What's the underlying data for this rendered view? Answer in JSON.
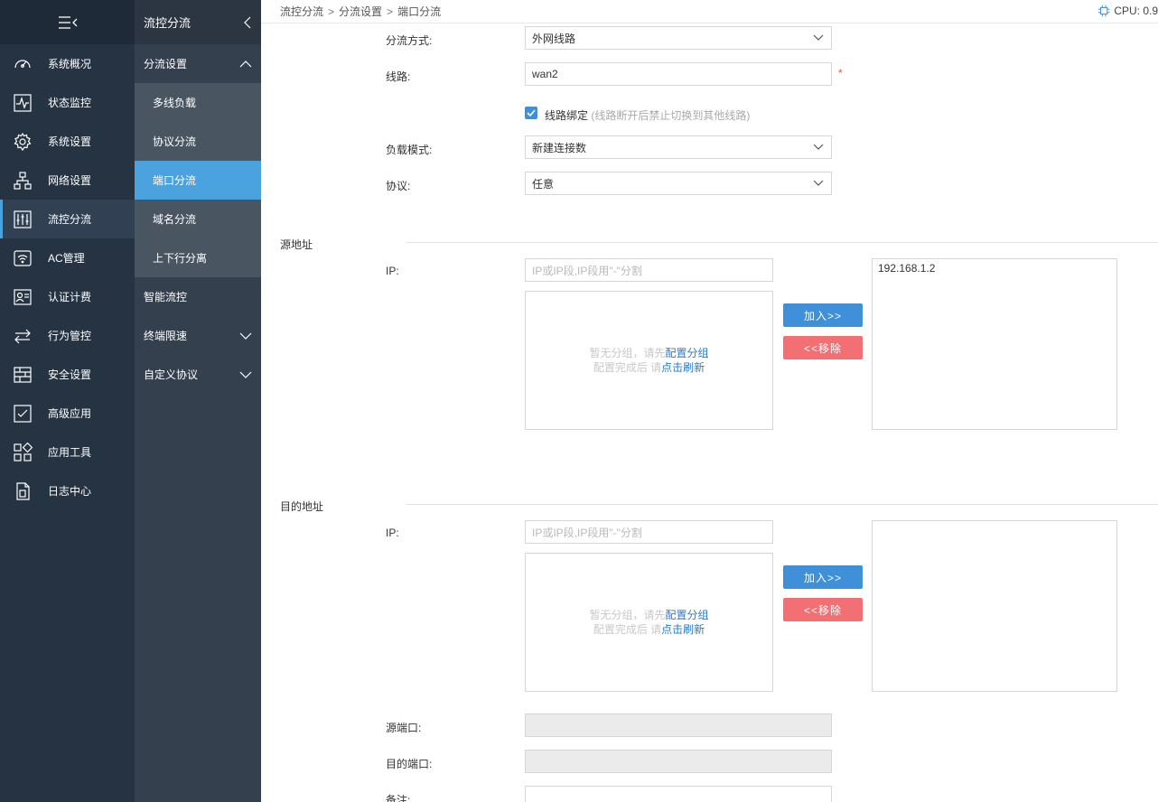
{
  "sidebar": {
    "toggle_icon": "menu-collapse-icon",
    "items": [
      {
        "label": "系统概况",
        "icon": "dashboard-icon"
      },
      {
        "label": "状态监控",
        "icon": "monitor-icon"
      },
      {
        "label": "系统设置",
        "icon": "gear-icon"
      },
      {
        "label": "网络设置",
        "icon": "network-icon"
      },
      {
        "label": "流控分流",
        "icon": "sliders-icon"
      },
      {
        "label": "AC管理",
        "icon": "wifi-icon"
      },
      {
        "label": "认证计费",
        "icon": "id-card-icon"
      },
      {
        "label": "行为管控",
        "icon": "arrows-exchange-icon"
      },
      {
        "label": "安全设置",
        "icon": "firewall-icon"
      },
      {
        "label": "高级应用",
        "icon": "checklist-icon"
      },
      {
        "label": "应用工具",
        "icon": "apps-icon"
      },
      {
        "label": "日志中心",
        "icon": "document-icon"
      }
    ]
  },
  "submenu": {
    "title": "流控分流",
    "groups": [
      {
        "label": "分流设置"
      },
      {
        "label": "智能流控"
      },
      {
        "label": "终端限速"
      },
      {
        "label": "自定义协议"
      }
    ],
    "children": [
      {
        "label": "多线负载"
      },
      {
        "label": "协议分流"
      },
      {
        "label": "端口分流"
      },
      {
        "label": "域名分流"
      },
      {
        "label": "上下行分离"
      }
    ]
  },
  "breadcrumb": [
    "流控分流",
    "分流设置",
    "端口分流"
  ],
  "breadcrumb_sep": ">",
  "cpu": {
    "label": "CPU: 0.9"
  },
  "form": {
    "mode_label": "分流方式:",
    "mode_value": "外网线路",
    "line_label": "线路:",
    "line_value": "wan2",
    "required_mark": "*",
    "bind_label": "线路绑定",
    "bind_hint": "(线路断开后禁止切换到其他线路)",
    "load_label": "负载模式:",
    "load_value": "新建连接数",
    "proto_label": "协议:",
    "proto_value": "任意",
    "src_port_label": "源端口:",
    "dst_port_label": "目的端口:",
    "note_label": "备注:"
  },
  "source": {
    "title": "源地址",
    "ip_label": "IP:",
    "ip_placeholder": "IP或IP段,IP段用\"-\"分割",
    "empty_line1": "暂无分组，请先",
    "empty_link1": "配置分组",
    "empty_line2": "配置完成后 请",
    "empty_link2": "点击刷新",
    "add_label": "加入>>",
    "remove_label": "<<移除",
    "selected": [
      "192.168.1.2"
    ]
  },
  "destination": {
    "title": "目的地址",
    "ip_label": "IP:",
    "ip_placeholder": "IP或IP段,IP段用\"-\"分割",
    "empty_line1": "暂无分组，请先",
    "empty_link1": "配置分组",
    "empty_line2": "配置完成后 请",
    "empty_link2": "点击刷新",
    "add_label": "加入>>",
    "remove_label": "<<移除",
    "selected": []
  },
  "colors": {
    "accent": "#4aa3df",
    "add_button": "#3f8fd9",
    "remove_button": "#f26f73",
    "sidebar": "#253343",
    "submenu": "#34404d"
  }
}
